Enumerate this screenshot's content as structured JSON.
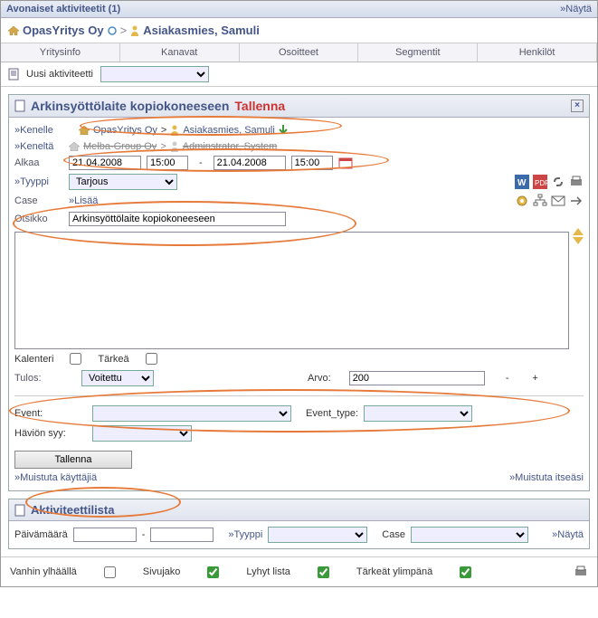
{
  "header": {
    "title": "Avonaiset aktiviteetit (1)",
    "show": "»Näytä"
  },
  "breadcrumb": {
    "company": "OpasYritys Oy",
    "contact": "Asiakasmies, Samuli"
  },
  "tabs": [
    "Yritysinfo",
    "Kanavat",
    "Osoitteet",
    "Segmentit",
    "Henkilöt"
  ],
  "newActivity": {
    "label": "Uusi aktiviteetti"
  },
  "activity": {
    "title": "Arkinsyöttölaite kopiokoneeseen",
    "saveHeader": "Tallenna",
    "kenelleLabel": "»Kenelle",
    "keneltaLabel": "»Keneltä",
    "kenelleCompany": "OpasYritys Oy",
    "kenelleContact": "Asiakasmies, Samuli",
    "keneltaCompany": "Melba-Group Oy",
    "keneltaContact": "Adminstrator, System",
    "alkaaLabel": "Alkaa",
    "startDate": "21.04.2008",
    "startTime": "15:00",
    "endDate": "21.04.2008",
    "endTime": "15:00",
    "typeLabel": "»Tyyppi",
    "typeValue": "Tarjous",
    "caseLabel": "Case",
    "caseLink": "»Lisää",
    "otsikkoLabel": "Otsikko",
    "otsikkoValue": "Arkinsyöttölaite kopiokoneeseen",
    "kalenteriLabel": "Kalenteri",
    "tarkeaLabel": "Tärkeä",
    "tulosLabel": "Tulos:",
    "tulosValue": "Voitettu",
    "arvoLabel": "Arvo:",
    "arvoValue": "200",
    "eventLabel": "Event:",
    "eventTypeLabel": "Event_type:",
    "havioLabel": "Häviön syy:",
    "tallennaBtn": "Tallenna",
    "remindUsers": "»Muistuta käyttäjiä",
    "remindSelf": "»Muistuta itseäsi"
  },
  "list": {
    "title": "Aktiviteettilista",
    "dateLabel": "Päivämäärä",
    "typeLabel": "»Tyyppi",
    "caseLabel": "Case",
    "show": "»Näytä"
  },
  "bottom": {
    "vanhin": "Vanhin ylhäällä",
    "sivujako": "Sivujako",
    "lyhyt": "Lyhyt lista",
    "tarkeat": "Tärkeät ylimpänä"
  }
}
